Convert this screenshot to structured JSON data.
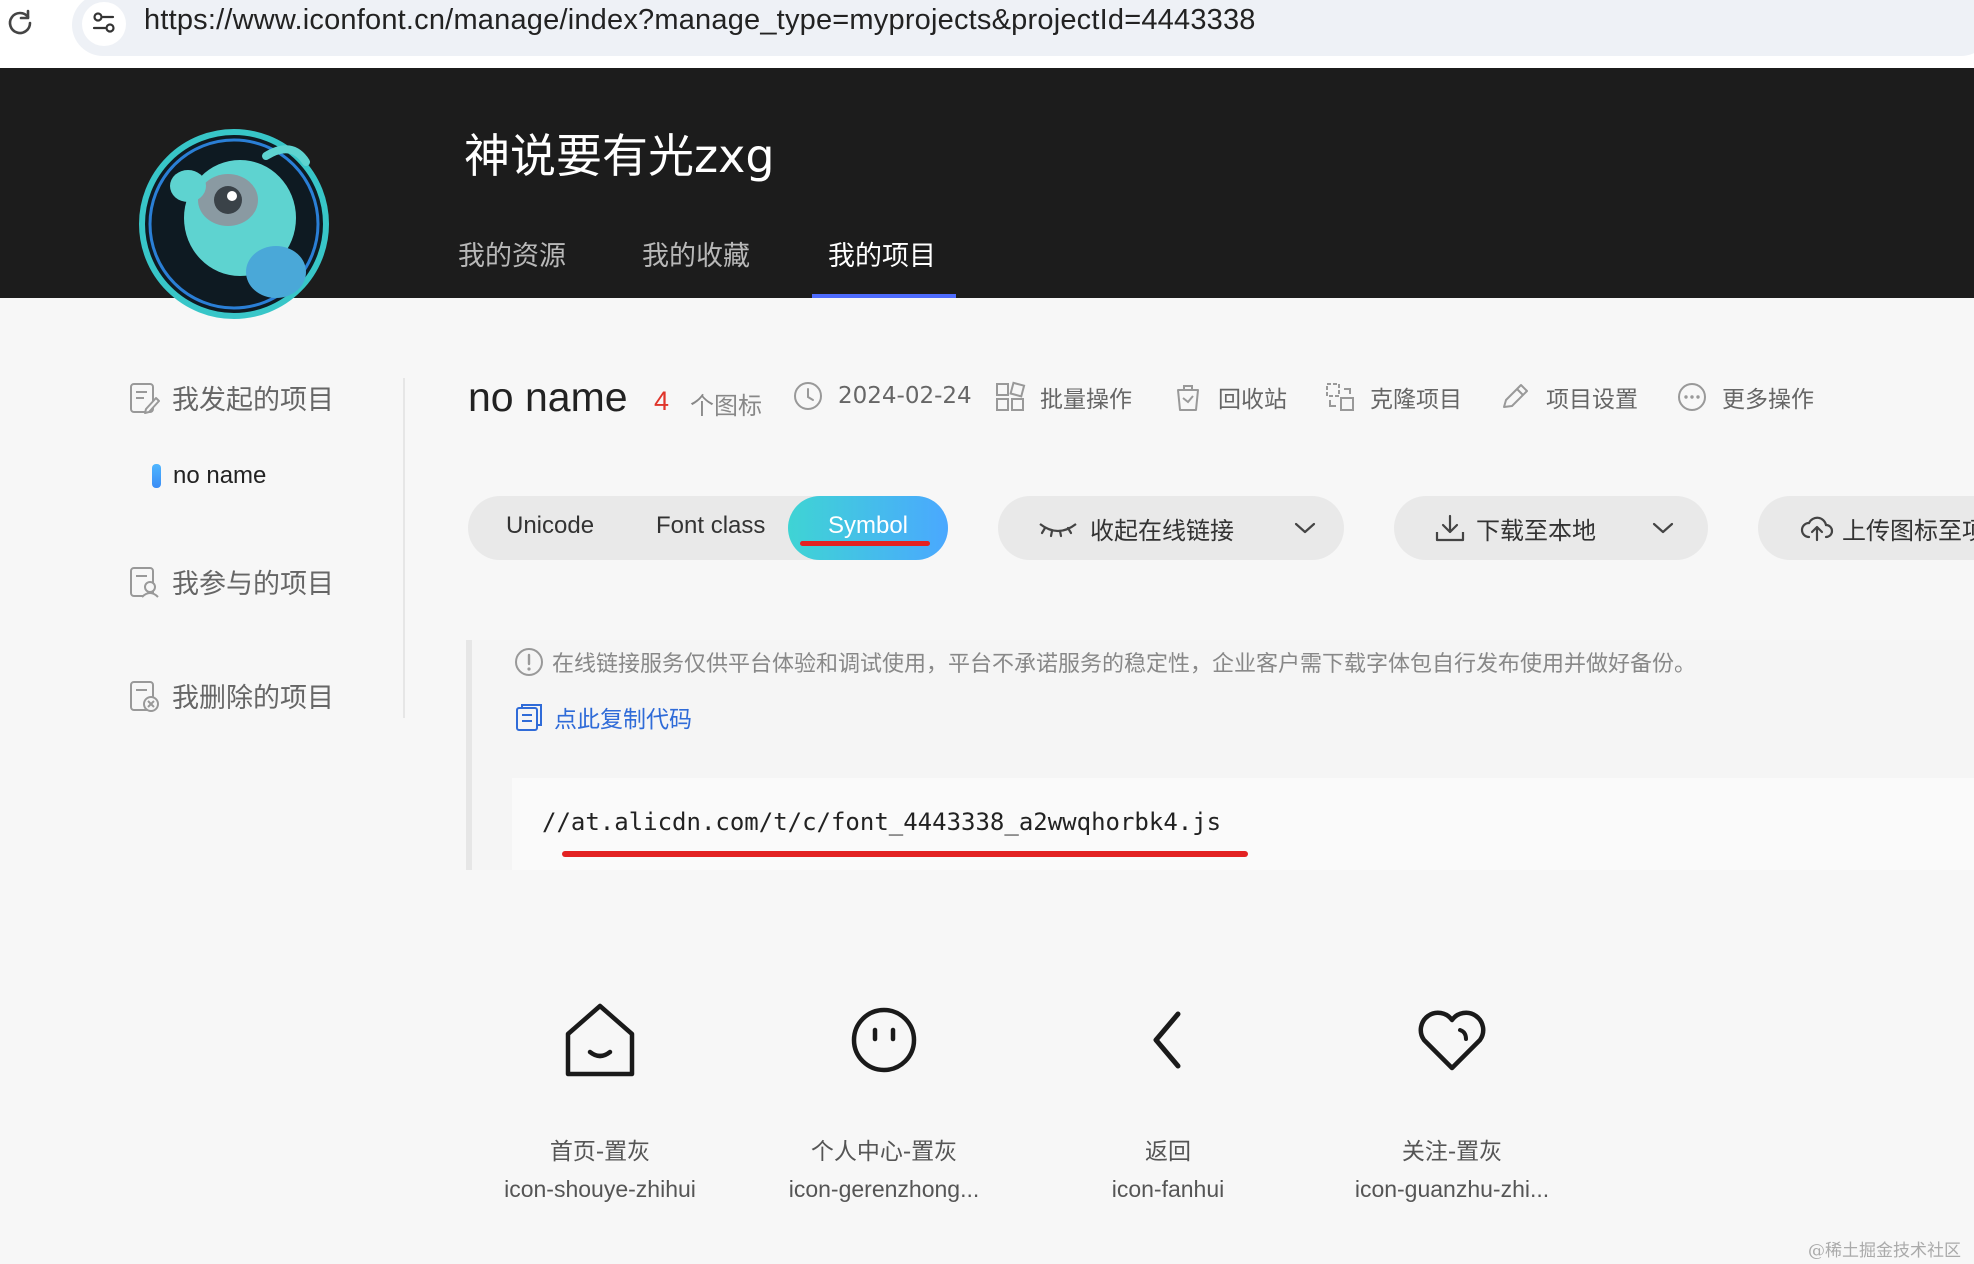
{
  "browser": {
    "url": "https://www.iconfont.cn/manage/index?manage_type=myprojects&projectId=4443338"
  },
  "header": {
    "username": "神说要有光zxg",
    "nav": [
      {
        "label": "我的资源",
        "active": false
      },
      {
        "label": "我的收藏",
        "active": false
      },
      {
        "label": "我的项目",
        "active": true
      }
    ],
    "accent_color": "#4d6bfe"
  },
  "sidebar": {
    "groups": [
      {
        "label": "我发起的项目",
        "icon": "edit-doc-icon"
      },
      {
        "label": "我参与的项目",
        "icon": "doc-user-icon"
      },
      {
        "label": "我删除的项目",
        "icon": "doc-delete-icon"
      }
    ],
    "active_project": "no name"
  },
  "project": {
    "name": "no name",
    "icon_count": "4",
    "icon_count_label": "个图标",
    "date": "2024-02-24",
    "actions": [
      {
        "label": "批量操作",
        "icon": "grid-icon"
      },
      {
        "label": "回收站",
        "icon": "trash-icon"
      },
      {
        "label": "克隆项目",
        "icon": "clone-icon"
      },
      {
        "label": "项目设置",
        "icon": "pencil-icon"
      },
      {
        "label": "更多操作",
        "icon": "more-icon"
      }
    ]
  },
  "tabs": {
    "items": [
      "Unicode",
      "Font class",
      "Symbol"
    ],
    "selected": "Symbol"
  },
  "buttons": {
    "collapse_link": "收起在线链接",
    "download": "下载至本地",
    "upload": "上传图标至项"
  },
  "code_panel": {
    "notice": "在线链接服务仅供平台体验和调试使用，平台不承诺服务的稳定性，企业客户需下载字体包自行发布使用并做好备份。",
    "copy_label": "点此复制代码",
    "code": "//at.alicdn.com/t/c/font_4443338_a2wwqhorbk4.js"
  },
  "icons": [
    {
      "name": "首页-置灰",
      "class": "icon-shouye-zhihui",
      "icon": "home-icon"
    },
    {
      "name": "个人中心-置灰",
      "class": "icon-gerenzhong...",
      "icon": "face-icon"
    },
    {
      "name": "返回",
      "class": "icon-fanhui",
      "icon": "back-chevron-icon"
    },
    {
      "name": "关注-置灰",
      "class": "icon-guanzhu-zhi...",
      "icon": "heart-icon"
    }
  ],
  "watermark": "@稀土掘金技术社区"
}
